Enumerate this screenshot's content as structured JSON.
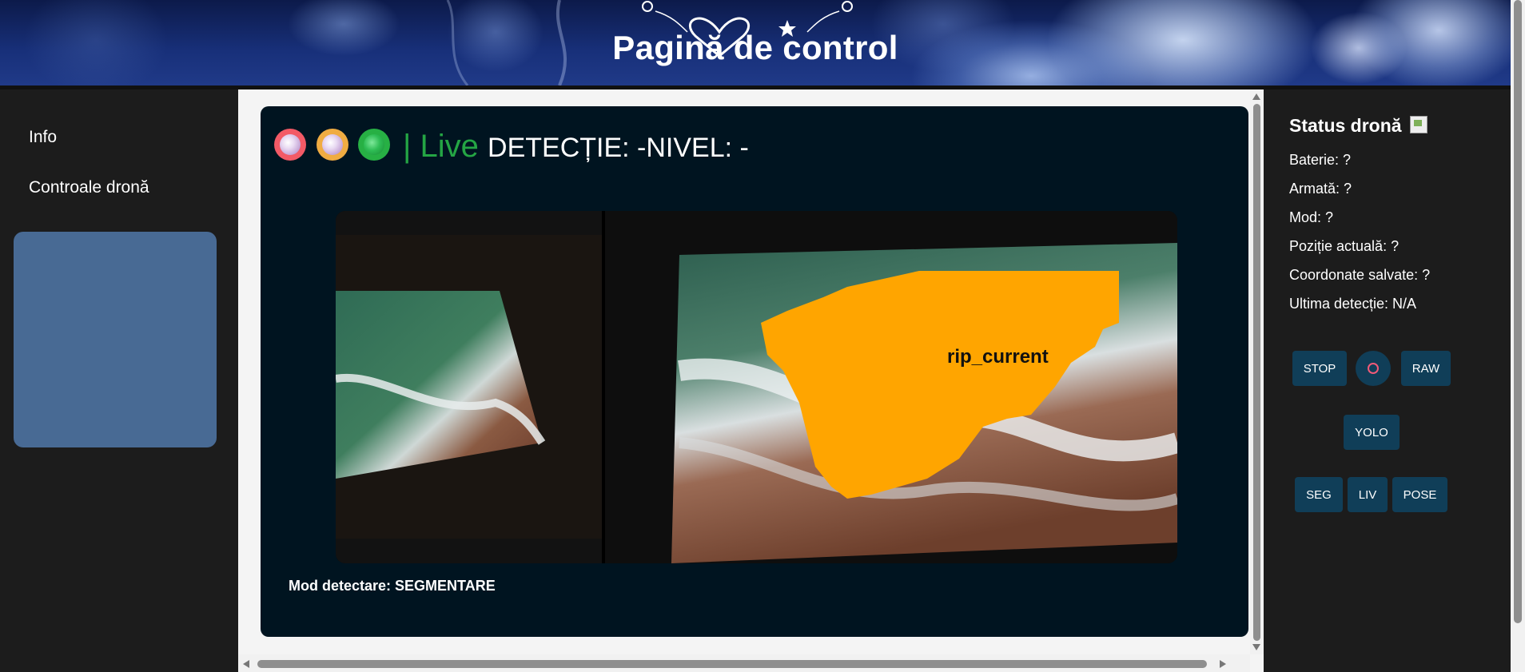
{
  "header": {
    "title": "Pagină de control"
  },
  "sidebar": {
    "items": [
      {
        "label": "Info"
      },
      {
        "label": "Controale dronă"
      }
    ]
  },
  "main": {
    "controls": {
      "separator": "|",
      "live_label": "Live",
      "detection_text": "DETECȚIE: -NIVEL: -"
    },
    "video": {
      "overlay_label": "rip_current"
    },
    "mode_text": "Mod detectare: SEGMENTARE"
  },
  "status": {
    "title": "Status dronă",
    "lines": [
      "Baterie: ?",
      "Armată: ?",
      "Mod: ?",
      "Poziție actuală: ?",
      "Coordonate salvate: ?",
      "Ultima detecție: N/A"
    ],
    "buttons": {
      "stop": "STOP",
      "raw": "RAW",
      "yolo": "YOLO",
      "seg": "SEG",
      "liv": "LIV",
      "pose": "POSE"
    }
  },
  "colors": {
    "live_green": "#24a544",
    "overlay_orange": "#ffa500",
    "sidebar_panel": "#486a94",
    "button_bg": "#103e58"
  }
}
